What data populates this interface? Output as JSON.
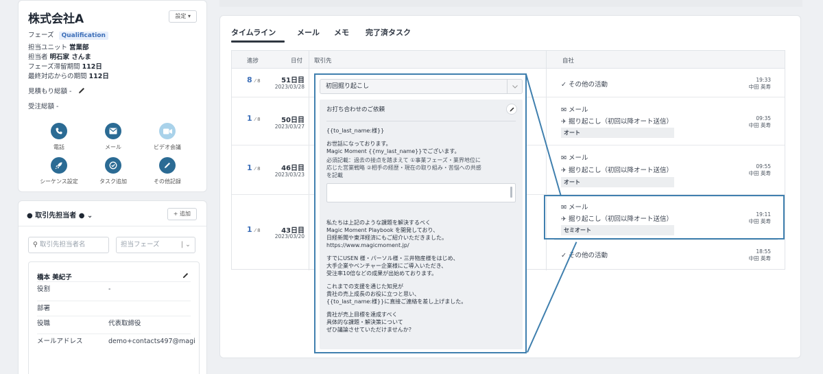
{
  "company": {
    "name": "株式会社A",
    "settings_label": "設定",
    "phase_label": "フェーズ",
    "phase_value": "Qualification",
    "unit_label": "担当ユニット",
    "unit_value": "営業部",
    "owner_label": "担当者",
    "owner_value": "明石家 さんま",
    "phase_days_label": "フェーズ滞留期間",
    "phase_days_value": "112日",
    "last_contact_label": "最終対応からの期間",
    "last_contact_value": "112日",
    "estimate_label": "見積もり総額 -",
    "order_label": "受注総額 -",
    "actions": [
      {
        "label": "電話",
        "icon": "phone-icon"
      },
      {
        "label": "メール",
        "icon": "mail-icon"
      },
      {
        "label": "ビデオ会議",
        "icon": "video-icon"
      },
      {
        "label": "シーケンス設定",
        "icon": "rocket-icon"
      },
      {
        "label": "タスク追加",
        "icon": "task-icon"
      },
      {
        "label": "その他記録",
        "icon": "pencil-icon"
      }
    ]
  },
  "contacts": {
    "title": "取引先担当者",
    "add_label": "+ 追加",
    "search_placeholder": "取引先担当者名",
    "phase_placeholder": "担当フェーズ",
    "contact_name": "橋本 美紀子",
    "fields": [
      {
        "key": "役割",
        "value": "-"
      },
      {
        "key": "部署",
        "value": ""
      },
      {
        "key": "役職",
        "value": "代表取締役"
      },
      {
        "key": "メールアドレス",
        "value": "demo+contacts497@magi"
      }
    ]
  },
  "tabs": [
    "タイムライン",
    "メール",
    "メモ",
    "完了済タスク"
  ],
  "table": {
    "headers": {
      "progress": "進捗",
      "date": "日付",
      "client": "取引先",
      "own": "自社"
    },
    "rows": [
      {
        "progress": "8",
        "total": "8",
        "day": "51日目",
        "date": "2023/03/28"
      },
      {
        "progress": "1",
        "total": "8",
        "day": "50日目",
        "date": "2023/03/27"
      },
      {
        "progress": "1",
        "total": "8",
        "day": "46日目",
        "date": "2023/03/23"
      },
      {
        "progress": "1",
        "total": "8",
        "day": "43日目",
        "date": "2023/03/20"
      }
    ],
    "activities": [
      {
        "title": "✓ その他の活動",
        "time": "19:33",
        "person": "中田 英寿"
      },
      {
        "title": "✉ メール",
        "sub": "✈ 掘り起こし（初回以降オート送信）",
        "tag": "オート",
        "time": "09:35",
        "person": "中田 英寿"
      },
      {
        "title": "✉ メール",
        "sub": "✈ 掘り起こし（初回以降オート送信）",
        "tag": "オート",
        "time": "09:55",
        "person": "中田 英寿"
      },
      {
        "title": "✉ メール",
        "sub": "✈ 掘り起こし（初回以降オート送信）",
        "tag": "セミオート",
        "time": "19:11",
        "person": "中田 英寿"
      },
      {
        "title": "✓ その他の活動",
        "time": "18:55",
        "person": "中田 英寿"
      }
    ]
  },
  "editor": {
    "template": "初回掘り起こし",
    "subject": "お打ち合わせのご依頼",
    "p1": "{{to_last_name:様}}",
    "p2": "お世話になっております。\nMagic Moment {{my_last_name}}でございます。",
    "p3": "必須記載：過去の接点を踏まえて ①事業フェーズ・業界地位に\n応じた営業戦略 ②相手の経歴・現在の取り組み・苦悩への共感\nを記載",
    "p4": "私たちは上記のような課題を解決するべく\nMagic Moment Playbook を開発しており、\n日経新聞や東洋経済にもご紹介いただきました。\nhttps://www.magicmoment.jp/",
    "p5": "すでにUSEN 様・パーソル様・三井物産様をはじめ、\n大手企業やベンチャー企業様にご導入いただき、\n受注率10倍などの成果が出始めております。",
    "p6": "これまでの支援を通じた知見が\n貴社の売上成長のお役に立つと思い、\n{{to_last_name:様}}に直接ご連絡を差し上げました。",
    "p7": "貴社が売上目標を達成すべく\n具体的な課題・解決策について\nぜひ議論させていただけませんか？"
  }
}
